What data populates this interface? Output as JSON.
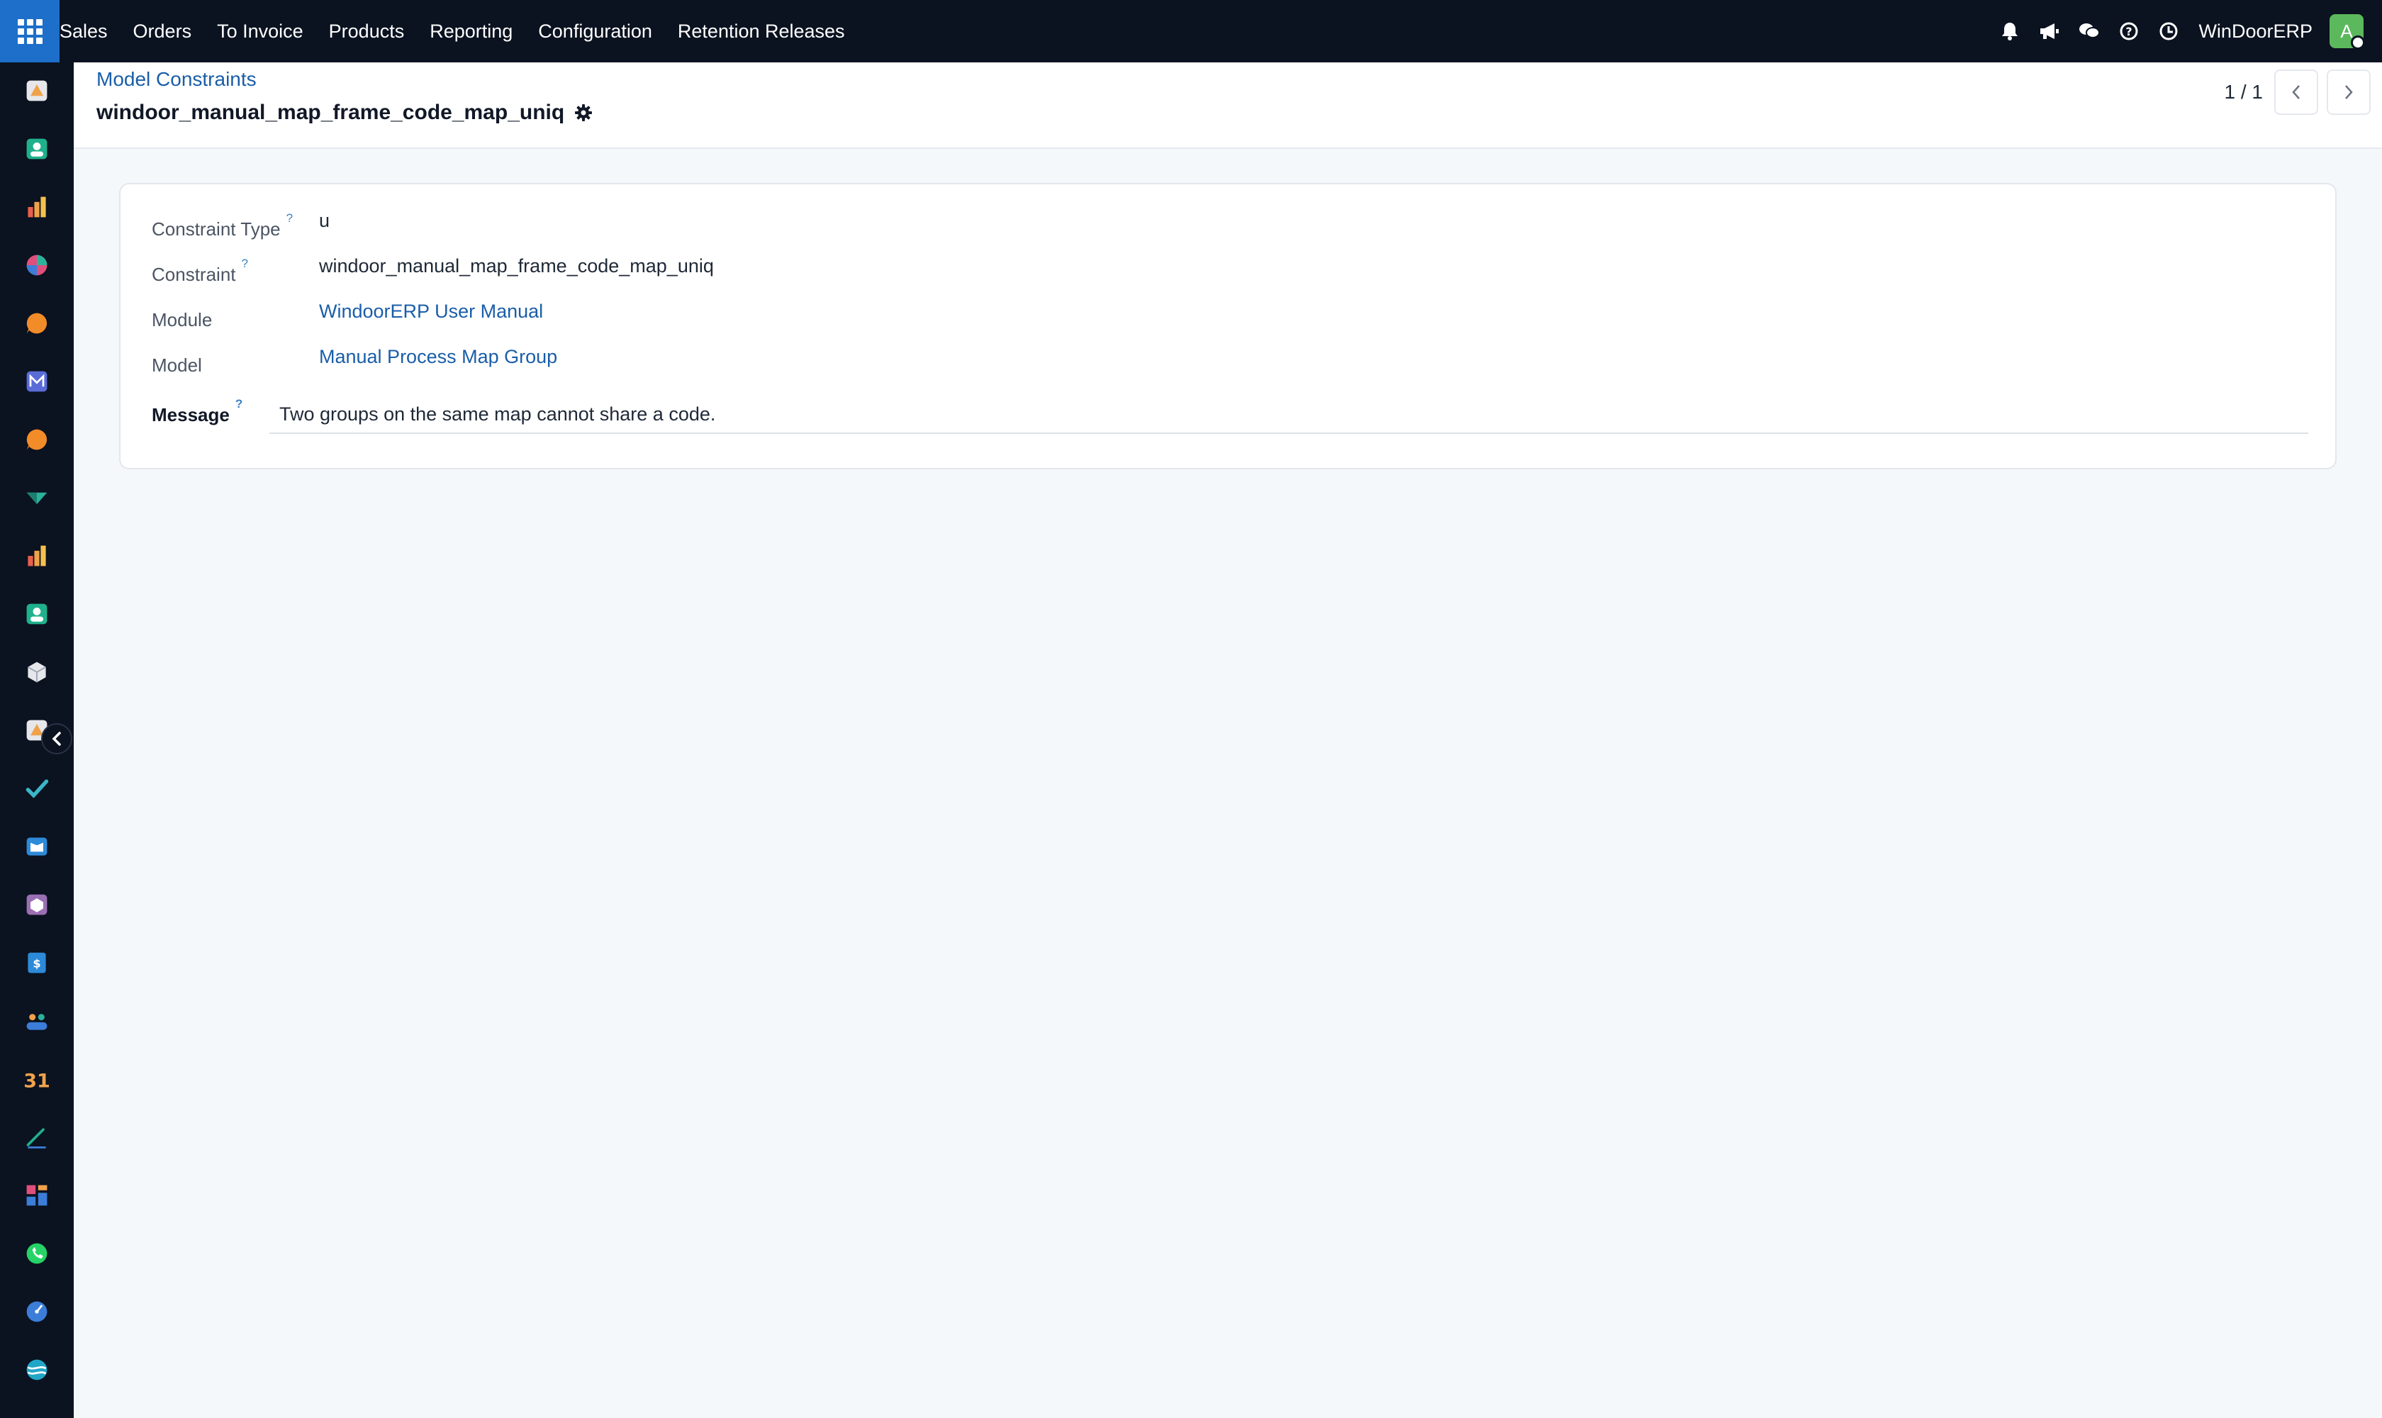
{
  "navbar": {
    "menu": [
      "Sales",
      "Orders",
      "To Invoice",
      "Products",
      "Reporting",
      "Configuration",
      "Retention Releases"
    ],
    "company": "WinDoorERP",
    "avatar_letter": "A"
  },
  "sidebar": {
    "apps": [
      {
        "icon": "puzzle-icon",
        "color": "#f0a24b"
      },
      {
        "icon": "contacts-icon",
        "color": "#1fb18b"
      },
      {
        "icon": "bar-chart-icon",
        "color": "#e8604c"
      },
      {
        "icon": "pie-chart-icon",
        "color": "#e04f7b"
      },
      {
        "icon": "chat-bubble-icon",
        "color": "#f28c28"
      },
      {
        "icon": "mail-icon",
        "color": "#5a6bd8"
      },
      {
        "icon": "chat-bubble-icon",
        "color": "#f28c28"
      },
      {
        "icon": "check-ribbon-icon",
        "color": "#2ab39a"
      },
      {
        "icon": "bar-chart-icon",
        "color": "#e8604c"
      },
      {
        "icon": "contacts-icon",
        "color": "#1fb18b"
      },
      {
        "icon": "box-icon",
        "color": "#e5e7eb"
      },
      {
        "icon": "puzzle-icon",
        "color": "#f0a24b"
      },
      {
        "icon": "checkmark-icon",
        "color": "#3ab6c9"
      },
      {
        "icon": "book-icon",
        "color": "#2d8ad8"
      },
      {
        "icon": "inventory-icon",
        "color": "#9b6fb3"
      },
      {
        "icon": "invoice-icon",
        "color": "#2d8ad8"
      },
      {
        "icon": "employees-icon",
        "color": "#f0a24b"
      },
      {
        "icon": "calendar-icon",
        "color": "#f0a24b"
      },
      {
        "icon": "sign-icon",
        "color": "#1fb18b"
      },
      {
        "icon": "dashboard-icon",
        "color": "#e04f7b"
      },
      {
        "icon": "whatsapp-icon",
        "color": "#25d366"
      },
      {
        "icon": "discuss-icon",
        "color": "#3b7dd8"
      },
      {
        "icon": "website-icon",
        "color": "#21a6c7"
      }
    ]
  },
  "control_panel": {
    "breadcrumb": "Model Constraints",
    "record_title": "windoor_manual_map_frame_code_map_uniq",
    "pager": "1 / 1"
  },
  "form": {
    "fields": [
      {
        "label": "Constraint Type",
        "has_tip": true,
        "value": "u",
        "is_link": false
      },
      {
        "label": "Constraint",
        "has_tip": true,
        "value": "windoor_manual_map_frame_code_map_uniq",
        "is_link": false
      },
      {
        "label": "Module",
        "has_tip": false,
        "value": "WindoorERP User Manual",
        "is_link": true
      },
      {
        "label": "Model",
        "has_tip": false,
        "value": "Manual Process Map Group",
        "is_link": true
      }
    ],
    "message": {
      "label": "Message",
      "value": "Two groups on the same map cannot share a code."
    },
    "tip_mark": "?"
  }
}
